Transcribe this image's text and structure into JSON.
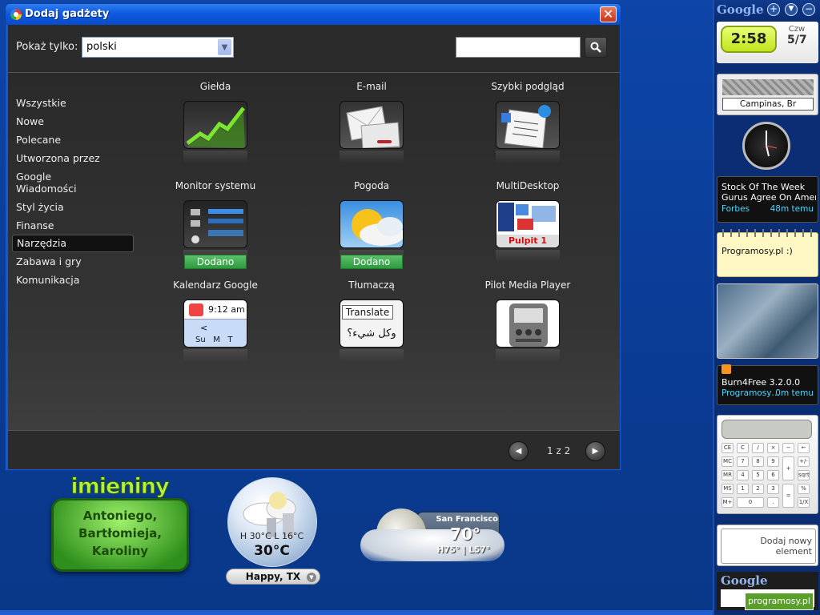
{
  "window": {
    "title": "Dodaj gadżety",
    "close_label": "✕"
  },
  "filter": {
    "show_label": "Pokaż tylko:",
    "language_value": "polski",
    "search_value": ""
  },
  "categories": [
    {
      "label": "Wszystkie"
    },
    {
      "label": "Nowe"
    },
    {
      "label": "Polecane"
    },
    {
      "label": "Utworzona przez Google"
    },
    {
      "label": "Wiadomości"
    },
    {
      "label": "Styl życia"
    },
    {
      "label": "Finanse"
    },
    {
      "label": "Narzędzia",
      "selected": true
    },
    {
      "label": "Zabawa i gry"
    },
    {
      "label": "Komunikacja"
    }
  ],
  "gadgets": [
    {
      "name": "Giełda",
      "icon": "stock-chart-icon",
      "added": false
    },
    {
      "name": "E-mail",
      "icon": "email-icon",
      "added": false
    },
    {
      "name": "Szybki podgląd",
      "icon": "quick-view-icon",
      "added": false
    },
    {
      "name": "Monitor systemu",
      "icon": "system-monitor-icon",
      "added": true,
      "added_label": "Dodano"
    },
    {
      "name": "Pogoda",
      "icon": "weather-icon",
      "added": true,
      "added_label": "Dodano"
    },
    {
      "name": "MultiDesktop",
      "icon": "multidesktop-icon",
      "added": false,
      "icon_text": "Pulpit 1"
    },
    {
      "name": "Kalendarz Google",
      "icon": "calendar-icon",
      "added": false,
      "icon_text": "9:12 am",
      "icon_sub": "Su   M   T"
    },
    {
      "name": "Tłumaczą",
      "icon": "translate-icon",
      "added": false,
      "icon_text": "Translate",
      "icon_sub": "وكل شيء؟"
    },
    {
      "name": "Pilot Media Player",
      "icon": "media-player-icon",
      "added": false
    }
  ],
  "pagination": {
    "text": "1 z 2"
  },
  "sidebar": {
    "google_label": "Google",
    "clock": {
      "time": "2:58",
      "day": "Czw",
      "date": "5/7"
    },
    "map": {
      "city": "Campinas, Br"
    },
    "news": {
      "line1": "Stock Of The Week",
      "line2": "Gurus Agree On Ameri…",
      "source": "Forbes",
      "age": "48m temu"
    },
    "notes": {
      "text": "Programosy.pl :)"
    },
    "rss": {
      "title": "Burn4Free 3.2.0.0",
      "source": "Programosy…",
      "age": "0m temu"
    },
    "add_new": "Dodaj nowy element",
    "search_google": "Google",
    "watermark": "programosy.pl"
  },
  "desktop": {
    "nameday": {
      "title": "imieniny",
      "names": [
        "Antoniego,",
        "Bartłomieja,",
        "Karoliny"
      ]
    },
    "weather_globe": {
      "hilo": "H 30°C  L 16°C",
      "temp": "30°C",
      "city": "Happy, TX"
    },
    "weather_sf": {
      "city": "San Francisco",
      "temp": "70°",
      "hilo": "H75° | L57°"
    }
  },
  "calculator_keys": [
    "CE",
    "C",
    "/",
    "×",
    "−",
    "←",
    "MC",
    "7",
    "8",
    "9",
    "+",
    "+/-",
    "MR",
    "4",
    "5",
    "6",
    "sqrt",
    "MS",
    "1",
    "2",
    "3",
    "=",
    "%",
    "M+",
    "0",
    ".",
    "1/X"
  ]
}
